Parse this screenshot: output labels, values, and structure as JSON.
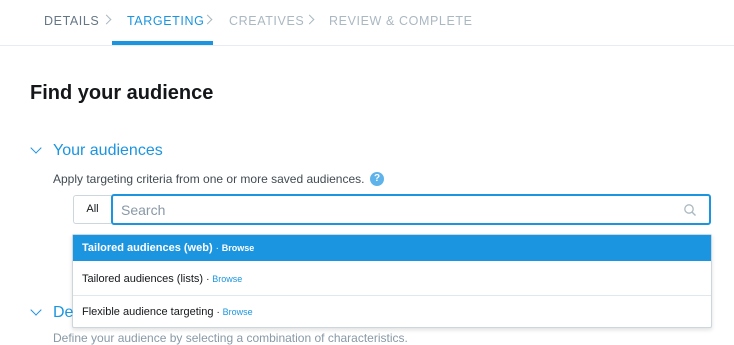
{
  "steps": [
    {
      "label": "DETAILS",
      "state": "done"
    },
    {
      "label": "TARGETING",
      "state": "active"
    },
    {
      "label": "CREATIVES",
      "state": "todo"
    },
    {
      "label": "REVIEW & COMPLETE",
      "state": "todo"
    }
  ],
  "page": {
    "title": "Find your audience"
  },
  "audiences_section": {
    "title": "Your audiences",
    "description": "Apply targeting criteria from one or more saved audiences.",
    "help_icon": "?",
    "filter_value": "All",
    "search_placeholder": "Search",
    "search_value": ""
  },
  "dropdown": {
    "items": [
      {
        "label": "Tailored audiences (web)",
        "separator": "·",
        "action": "Browse",
        "highlighted": true
      },
      {
        "label": "Tailored audiences (lists)",
        "separator": "·",
        "action": "Browse",
        "highlighted": false
      },
      {
        "label": "Flexible audience targeting",
        "separator": "·",
        "action": "Browse",
        "highlighted": false
      }
    ]
  },
  "second_section": {
    "title_visible": "De",
    "text_visible": "Define your audience by selecting a combination of characteristics."
  },
  "colors": {
    "accent": "#1b95e0",
    "muted": "#aab8c2",
    "text": "#14171a"
  }
}
